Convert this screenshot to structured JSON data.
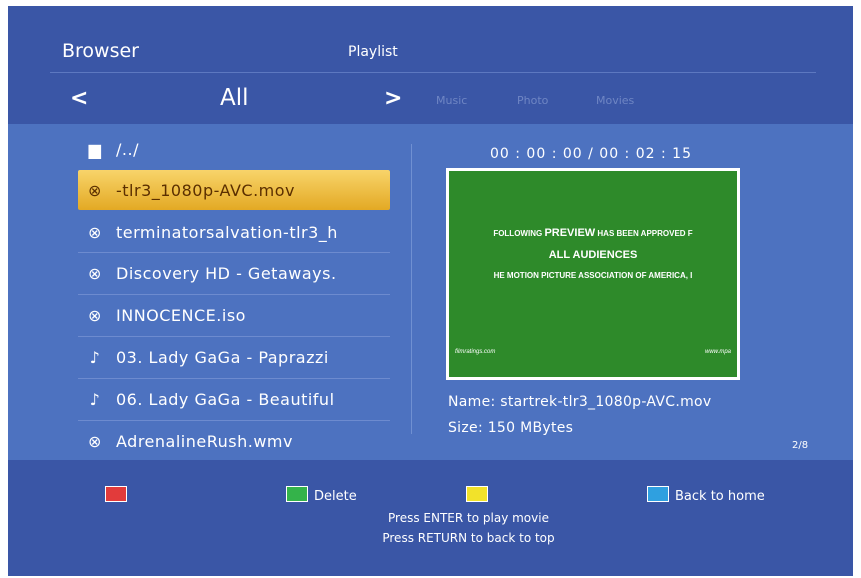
{
  "header": {
    "title": "Browser",
    "playlist_tab": "Playlist"
  },
  "filter_bar": {
    "current": "All",
    "prev_icon": "<",
    "next_icon": ">",
    "options": [
      "Music",
      "Photo",
      "Movies"
    ]
  },
  "file_list": {
    "items": [
      {
        "icon": "folder-icon",
        "glyph": "▆",
        "label": "/../"
      },
      {
        "icon": "disc-icon",
        "glyph": "⊗",
        "label": "-tlr3_1080p-AVC.mov",
        "selected": true
      },
      {
        "icon": "disc-icon",
        "glyph": "⊗",
        "label": "terminatorsalvation-tlr3_h"
      },
      {
        "icon": "disc-icon",
        "glyph": "⊗",
        "label": "Discovery HD - Getaways."
      },
      {
        "icon": "disc-icon",
        "glyph": "⊗",
        "label": "INNOCENCE.iso"
      },
      {
        "icon": "music-note-icon",
        "glyph": "♪",
        "label": "03. Lady GaGa - Paprazzi"
      },
      {
        "icon": "music-note-icon",
        "glyph": "♪",
        "label": "06. Lady GaGa - Beautiful"
      },
      {
        "icon": "disc-icon",
        "glyph": "⊗",
        "label": "AdrenalineRush.wmv"
      }
    ]
  },
  "preview": {
    "timecode": "00 : 00 : 00 / 00 : 02 : 15",
    "thumbnail": {
      "line1_pre": "FOLLOWING",
      "line1_bold": "PREVIEW",
      "line1_post": "HAS BEEN APPROVED F",
      "line2": "ALL AUDIENCES",
      "line3": "HE MOTION PICTURE ASSOCIATION OF AMERICA, I",
      "footer_left": "filmratings.com",
      "footer_right": "www.mpa"
    },
    "name": "Name: startrek-tlr3_1080p-AVC.mov",
    "size": "Size: 150 MBytes"
  },
  "pager": "2/8",
  "footer": {
    "keys": {
      "red_label": "",
      "green_label": "Delete",
      "yellow_label": "",
      "blue_label": "Back to home"
    },
    "colors": {
      "red": "#e23b3b",
      "green": "#34b34a",
      "yellow": "#f2e22a",
      "blue": "#2fa0e0"
    },
    "hint_play": "Press ENTER to play movie",
    "hint_return": "Press RETURN to back to top"
  },
  "colors": {
    "background": "#3a56a6",
    "panel": "#4d72c0",
    "selection": "#e9b53a"
  }
}
